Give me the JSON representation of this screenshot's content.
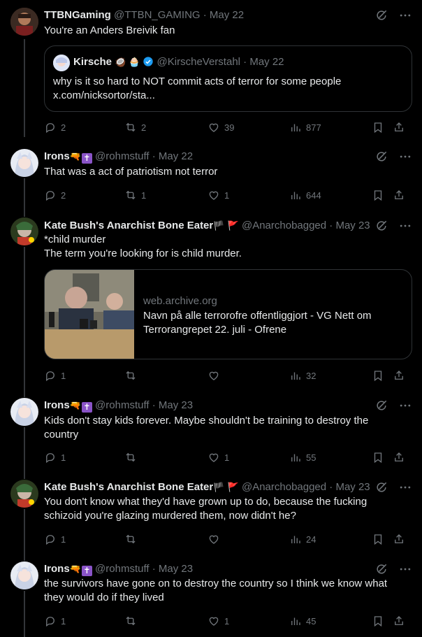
{
  "tweets": [
    {
      "name": "TTBNGaming",
      "handle": "@TTBN_GAMING",
      "date": "· May 22",
      "text": "You're an Anders Breivik fan",
      "quote": {
        "name": "Kirsche",
        "name_emojis": "🥥 🧁",
        "handle": "@KirscheVerstahl",
        "date": "· May 22",
        "text_line1": "why is it so hard to NOT commit acts of terror for some people",
        "text_line2": "x.com/nicksortor/sta..."
      },
      "replies": "2",
      "retweets": "2",
      "likes": "39",
      "views": "877"
    },
    {
      "name": "Irons",
      "handle": "@rohmstuff",
      "date": "· May 22",
      "text": "That was a act of patriotism not terror",
      "replies": "2",
      "retweets": "1",
      "likes": "1",
      "views": "644"
    },
    {
      "name": "Kate Bush's Anarchist Bone Eater",
      "handle": "@Anarchobagged",
      "date": "· May 23",
      "text_line1": "*child murder",
      "text_line2": "The term you're looking for is child murder.",
      "card": {
        "domain": "web.archive.org",
        "title_line1": "Navn på alle terrorofre offentliggjort - VG Nett om",
        "title_line2": "Terrorangrepet 22. juli - Ofrene"
      },
      "replies": "1",
      "retweets": "",
      "likes": "",
      "views": "32"
    },
    {
      "name": "Irons",
      "handle": "@rohmstuff",
      "date": "· May 23",
      "text_line1": "Kids don't stay kids forever. Maybe shouldn't be training to destroy the",
      "text_line2": "country",
      "replies": "1",
      "retweets": "",
      "likes": "1",
      "views": "55"
    },
    {
      "name": "Kate Bush's Anarchist Bone Eater",
      "handle": "@Anarchobagged",
      "date": "· May 23",
      "text_line1": "You don't know what they'd have grown up to do, because the fucking",
      "text_line2": "schizoid you're glazing murdered them, now didn't he?",
      "replies": "1",
      "retweets": "",
      "likes": "",
      "views": "24"
    },
    {
      "name": "Irons",
      "handle": "@rohmstuff",
      "date": "· May 23",
      "text_line1": "the survivors have gone on to destroy the country so I think we know what",
      "text_line2": "they would do if they lived",
      "replies": "1",
      "retweets": "",
      "likes": "1",
      "views": "45"
    }
  ],
  "colors": {
    "text": "#e7e9ea",
    "muted": "#71767b",
    "border": "#2f3336",
    "verified": "#1d9bf0",
    "badge": "#8a54c8"
  },
  "icons": [
    "grok-icon",
    "more-icon",
    "reply-icon",
    "retweet-icon",
    "like-icon",
    "views-icon",
    "bookmark-icon",
    "share-icon",
    "verified-icon",
    "gun-emoji",
    "cross-badge",
    "flag-emoji"
  ]
}
